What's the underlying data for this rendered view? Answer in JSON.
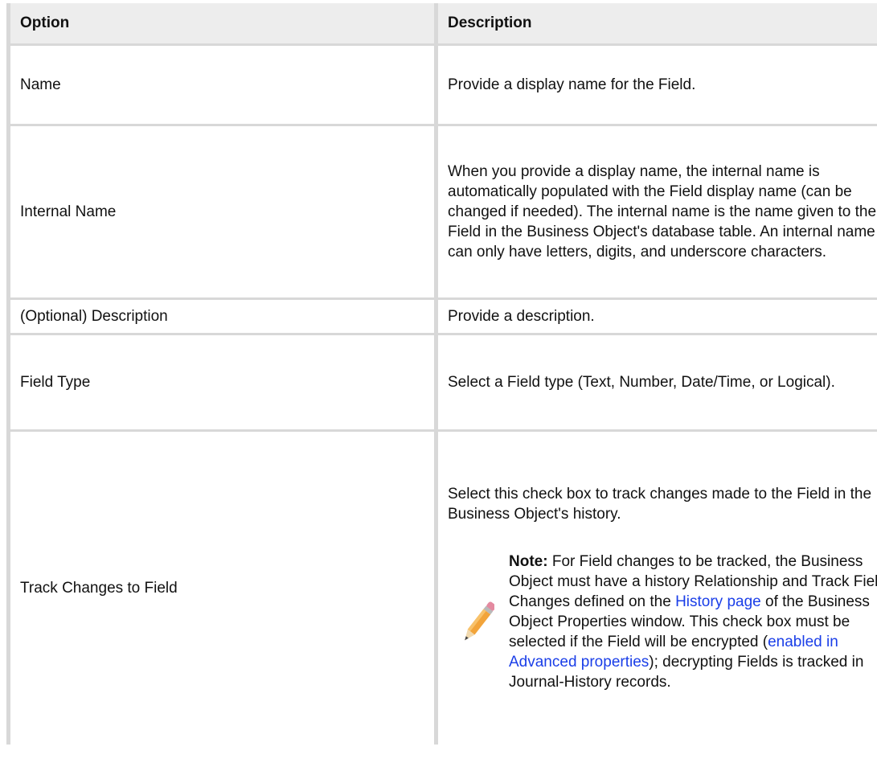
{
  "table": {
    "headers": [
      "Option",
      "Description"
    ],
    "rows": {
      "name": {
        "option": "Name",
        "description": "Provide a display name for the Field."
      },
      "internal": {
        "option": "Internal Name",
        "description": "When you provide a display name, the internal name is automatically populated with the Field display name (can be changed if needed). The internal name is the name given to the Field in the Business Object's database table. An internal name can only have letters, digits, and underscore characters."
      },
      "desc": {
        "option": "(Optional) Description",
        "description": "Provide a description."
      },
      "type": {
        "option": "Field Type",
        "description": "Select a Field type (Text, Number, Date/Time, or Logical)."
      },
      "track": {
        "option": "Track Changes to Field",
        "description": "Select this check box to track changes made to the Field in the Business Object's history.",
        "note": {
          "label": "Note:",
          "text_1": " For Field changes to be tracked, the Business Object must have a history Relationship and Track Field Changes defined on the ",
          "link_1": "History page",
          "text_2": " of the Business Object Properties window. This check box must be selected if the Field will be encrypted (",
          "link_2": "enabled in Advanced properties",
          "text_3": "); decrypting Fields is tracked in Journal-History records.",
          "icon": "pencil-icon"
        }
      }
    }
  },
  "colors": {
    "link": "#1a3ee8",
    "header_bg": "#ededed",
    "border": "#d8d8d8"
  }
}
